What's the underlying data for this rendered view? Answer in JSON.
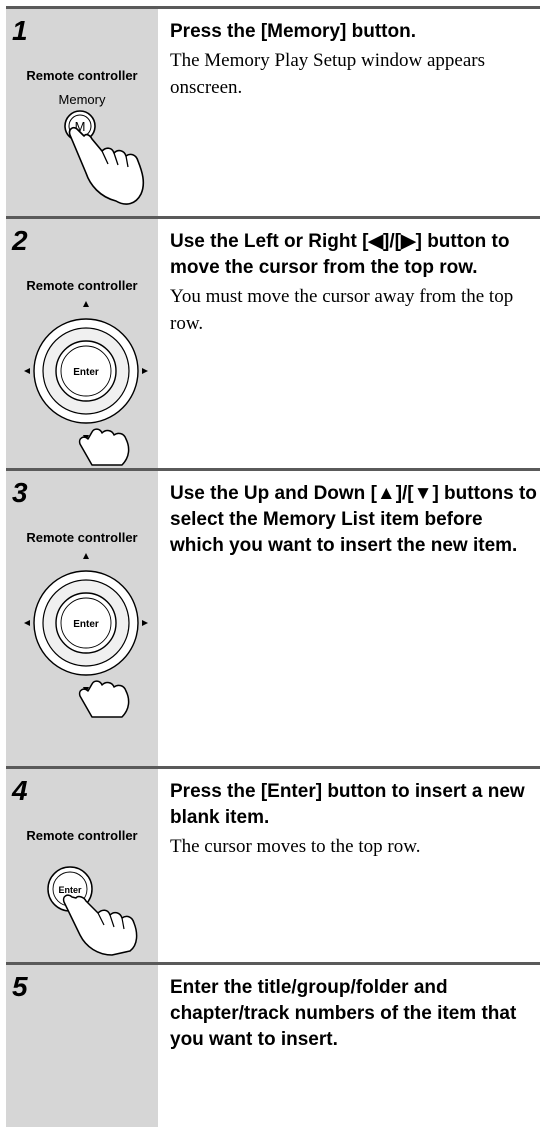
{
  "steps": [
    {
      "number": "1",
      "device_label": "Remote controller",
      "button_label": "Memory",
      "button_glyph": "M",
      "title": "Press the [Memory] button.",
      "body": "The Memory Play Setup window appears onscreen.",
      "icon": "memory-button-icon"
    },
    {
      "number": "2",
      "device_label": "Remote controller",
      "button_glyph": "Enter",
      "title": "Use the Left or Right [◀]/[▶] button to move the cursor from the top row.",
      "body": "You must move the cursor away from the top row.",
      "icon": "navigation-pad-icon"
    },
    {
      "number": "3",
      "device_label": "Remote controller",
      "button_glyph": "Enter",
      "title": "Use the Up and Down [▲]/[▼] buttons to select the Memory List item before which you want to insert the new item.",
      "body": "",
      "icon": "navigation-pad-icon"
    },
    {
      "number": "4",
      "device_label": "Remote controller",
      "button_glyph": "Enter",
      "title": "Press the [Enter] button to insert a new blank item.",
      "body": "The cursor moves to the top row.",
      "icon": "enter-button-icon"
    },
    {
      "number": "5",
      "title": "Enter the title/group/folder and chapter/track numbers of the item that you want to insert.",
      "body": ""
    }
  ],
  "colors": {
    "panel": "#d6d6d6",
    "rule": "#5a5a5a"
  }
}
